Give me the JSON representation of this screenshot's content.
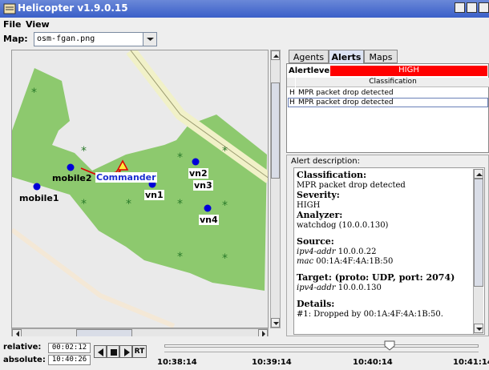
{
  "window": {
    "title": "Helicopter v1.9.0.15"
  },
  "menu": [
    "File",
    "View"
  ],
  "map_selector": {
    "label": "Map:",
    "value": "osm-fgan.png"
  },
  "map": {
    "nodes": [
      {
        "label": "mobile1"
      },
      {
        "label": "mobile2"
      },
      {
        "label": "Commander"
      },
      {
        "label": "vn1"
      },
      {
        "label": "vn2"
      },
      {
        "label": "vn3"
      },
      {
        "label": "vn4"
      }
    ]
  },
  "tabs": [
    "Agents",
    "Alerts",
    "Maps"
  ],
  "alerts": {
    "alertlevel_label": "Alertlevel:",
    "alertlevel_value": "HIGH",
    "column_header": "Classification",
    "rows": [
      {
        "prefix": "H",
        "text": "MPR packet drop detected"
      },
      {
        "prefix": "H",
        "text": "MPR packet drop detected"
      }
    ]
  },
  "description": {
    "title": "Alert description:",
    "classification_label": "Classification:",
    "classification_value": "MPR packet drop detected",
    "severity_label": "Severity:",
    "severity_value": "HIGH",
    "analyzer_label": "Analyzer:",
    "analyzer_value": "watchdog (10.0.0.130)",
    "source_label": "Source:",
    "source_ipv4_key": "ipv4-addr",
    "source_ipv4_val": "10.0.0.22",
    "source_mac_key": "mac",
    "source_mac_val": "00:1A:4F:4A:1B:50",
    "target_label": "Target: (proto: UDP, port: 2074)",
    "target_ipv4_key": "ipv4-addr",
    "target_ipv4_val": "10.0.0.130",
    "details_label": "Details:",
    "details_value": "#1: Dropped by 00:1A:4F:4A:1B:50."
  },
  "timeline": {
    "relative_label": "relative:",
    "relative_value": "00:02:12",
    "absolute_label": "absolute:",
    "absolute_value": "10:40:26",
    "rt_label": "RT",
    "ticks": [
      "10:38:14",
      "10:39:14",
      "10:40:14",
      "10:41:14"
    ]
  }
}
